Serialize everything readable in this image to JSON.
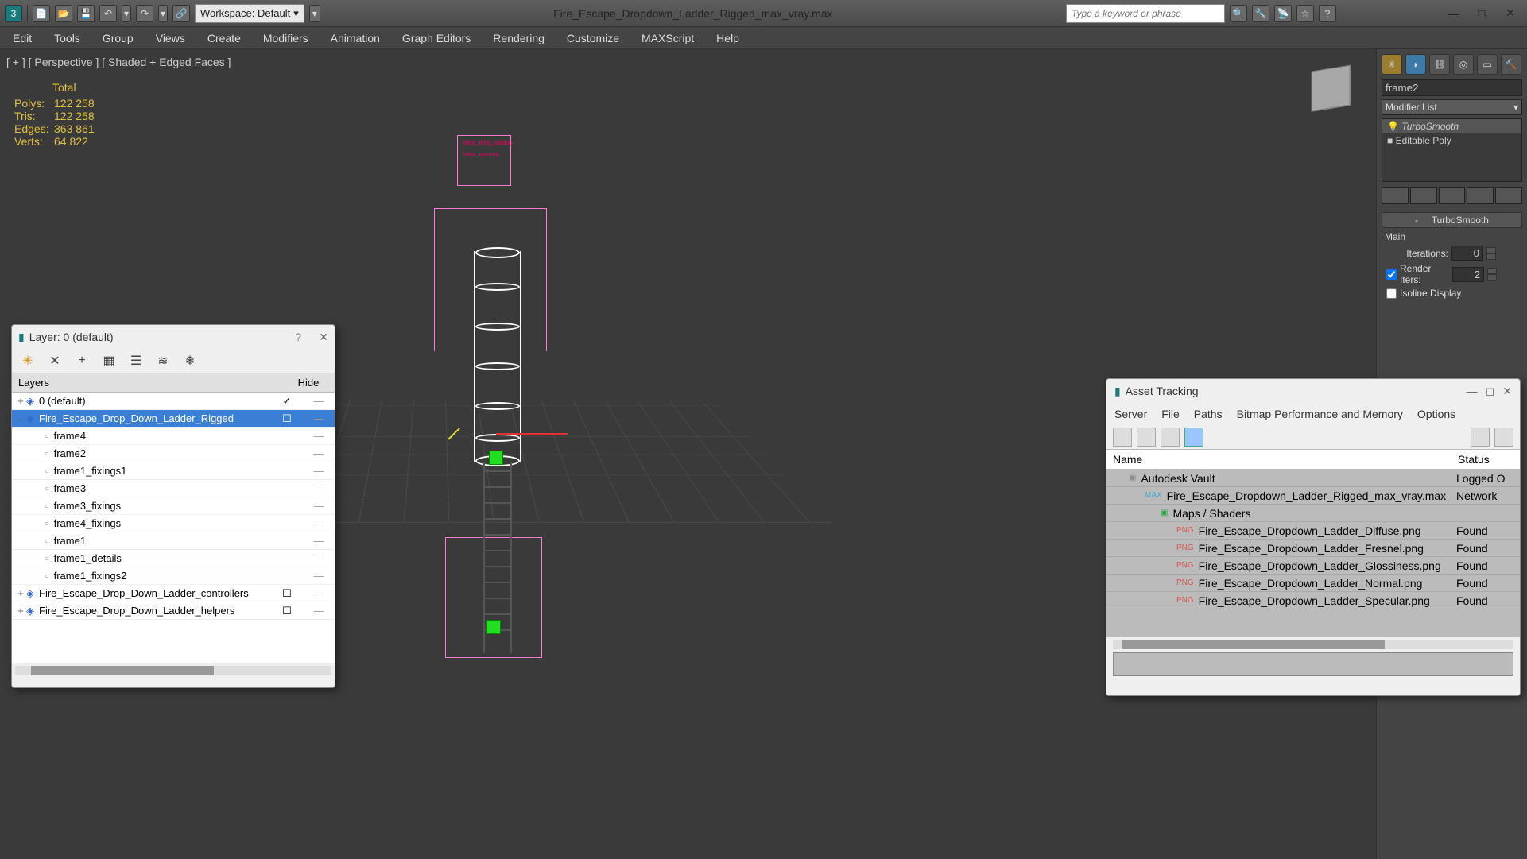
{
  "toolbar": {
    "workspace_label": "Workspace: Default",
    "file_title": "Fire_Escape_Dropdown_Ladder_Rigged_max_vray.max",
    "search_placeholder": "Type a keyword or phrase"
  },
  "menu": [
    "Edit",
    "Tools",
    "Group",
    "Views",
    "Create",
    "Modifiers",
    "Animation",
    "Graph Editors",
    "Rendering",
    "Customize",
    "MAXScript",
    "Help"
  ],
  "viewport": {
    "label": "[ + ] [ Perspective ] [ Shaded + Edged Faces ]",
    "stats_title": "Total",
    "stats": [
      {
        "k": "Polys:",
        "v": "122 258"
      },
      {
        "k": "Tris:",
        "v": "122 258"
      },
      {
        "k": "Edges:",
        "v": "363 861"
      },
      {
        "k": "Verts:",
        "v": "64 822"
      }
    ]
  },
  "right_panel": {
    "object_name": "frame2",
    "modifier_list_label": "Modifier List",
    "modifiers": [
      "TurboSmooth",
      "Editable Poly"
    ],
    "section_title": "TurboSmooth",
    "main_label": "Main",
    "iterations_label": "Iterations:",
    "iterations_value": "0",
    "render_iters_label": "Render Iters:",
    "render_iters_value": "2",
    "isoline_label": "Isoline Display"
  },
  "layer_panel": {
    "title": "Layer: 0 (default)",
    "col_layers": "Layers",
    "col_hide": "Hide",
    "rows": [
      {
        "label": "0 (default)",
        "depth": 0,
        "expand": "+",
        "layer": true,
        "checked": true
      },
      {
        "label": "Fire_Escape_Drop_Down_Ladder_Rigged",
        "depth": 0,
        "expand": "-",
        "layer": true,
        "selected": true,
        "cb": true
      },
      {
        "label": "frame4",
        "depth": 1
      },
      {
        "label": "frame2",
        "depth": 1
      },
      {
        "label": "frame1_fixings1",
        "depth": 1
      },
      {
        "label": "frame3",
        "depth": 1
      },
      {
        "label": "frame3_fixings",
        "depth": 1
      },
      {
        "label": "frame4_fixings",
        "depth": 1
      },
      {
        "label": "frame1",
        "depth": 1
      },
      {
        "label": "frame1_details",
        "depth": 1
      },
      {
        "label": "frame1_fixings2",
        "depth": 1
      },
      {
        "label": "Fire_Escape_Drop_Down_Ladder_controllers",
        "depth": 0,
        "expand": "+",
        "layer": true,
        "cb": true
      },
      {
        "label": "Fire_Escape_Drop_Down_Ladder_helpers",
        "depth": 0,
        "expand": "+",
        "layer": true,
        "cb": true
      }
    ]
  },
  "asset_panel": {
    "title": "Asset Tracking",
    "menu": [
      "Server",
      "File",
      "Paths",
      "Bitmap Performance and Memory",
      "Options"
    ],
    "col_name": "Name",
    "col_status": "Status",
    "rows": [
      {
        "label": "Autodesk Vault",
        "status": "Logged O",
        "depth": 0,
        "icon": "vault"
      },
      {
        "label": "Fire_Escape_Dropdown_Ladder_Rigged_max_vray.max",
        "status": "Network",
        "depth": 1,
        "icon": "max"
      },
      {
        "label": "Maps / Shaders",
        "status": "",
        "depth": 2,
        "icon": "folder"
      },
      {
        "label": "Fire_Escape_Dropdown_Ladder_Diffuse.png",
        "status": "Found",
        "depth": 3,
        "icon": "png"
      },
      {
        "label": "Fire_Escape_Dropdown_Ladder_Fresnel.png",
        "status": "Found",
        "depth": 3,
        "icon": "png"
      },
      {
        "label": "Fire_Escape_Dropdown_Ladder_Glossiness.png",
        "status": "Found",
        "depth": 3,
        "icon": "png"
      },
      {
        "label": "Fire_Escape_Dropdown_Ladder_Normal.png",
        "status": "Found",
        "depth": 3,
        "icon": "png"
      },
      {
        "label": "Fire_Escape_Dropdown_Ladder_Specular.png",
        "status": "Found",
        "depth": 3,
        "icon": "png"
      }
    ]
  }
}
